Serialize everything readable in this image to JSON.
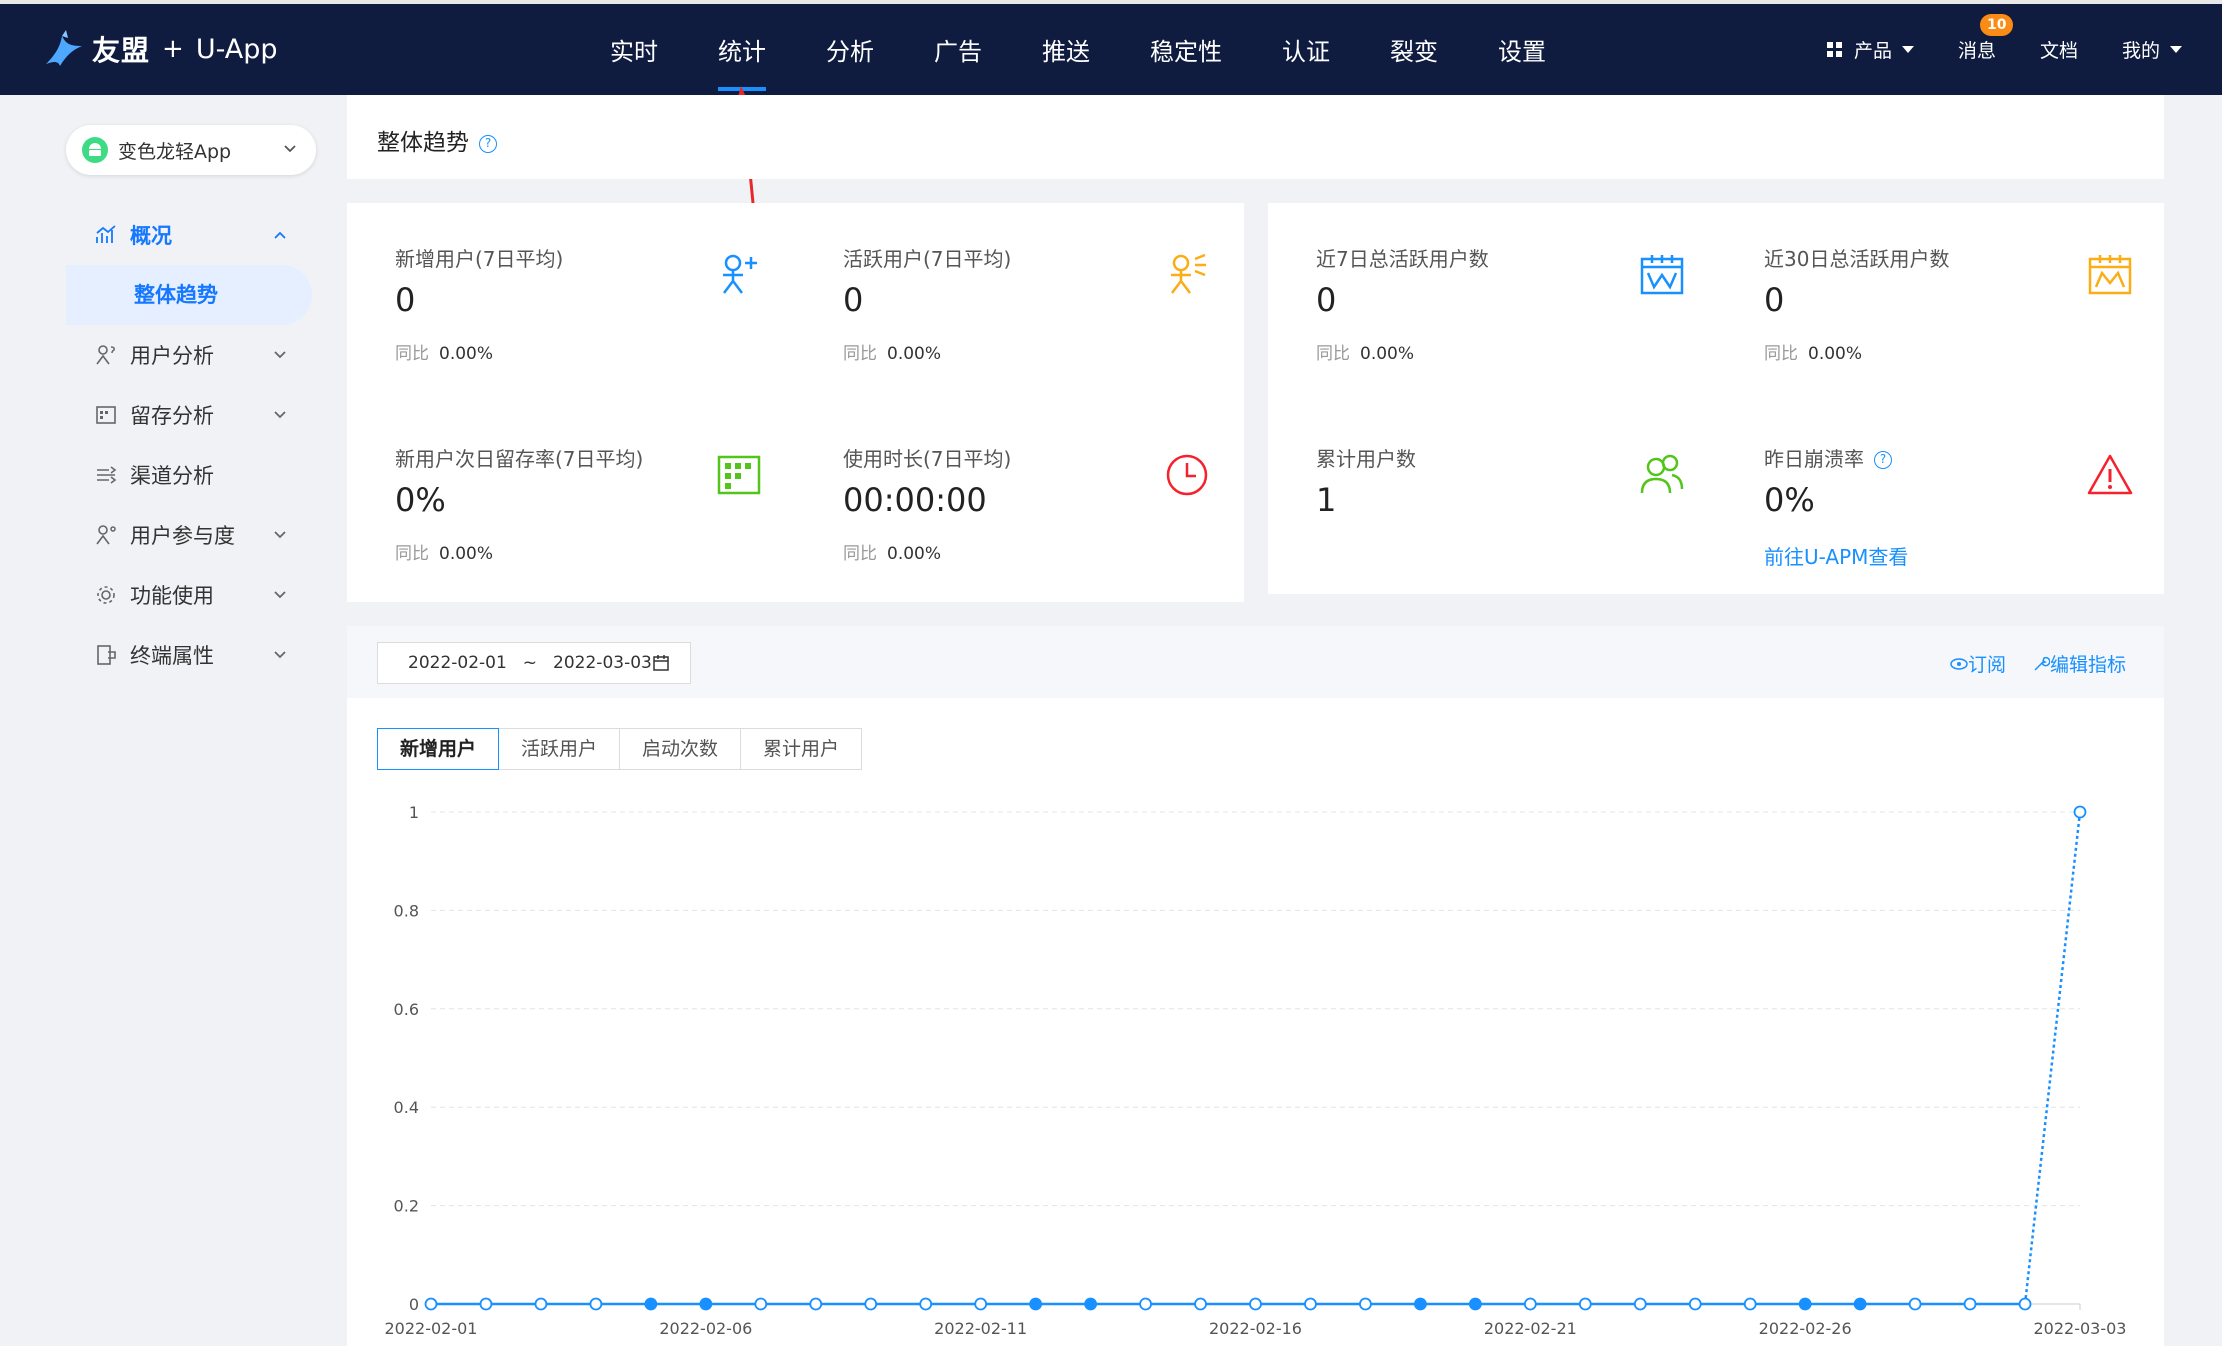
{
  "header": {
    "brand": "友盟",
    "plus": "+",
    "app_name": "U-App",
    "nav": [
      "实时",
      "统计",
      "分析",
      "广告",
      "推送",
      "稳定性",
      "认证",
      "裂变",
      "设置"
    ],
    "active_nav": 1,
    "right": {
      "products": "产品",
      "messages": "消息",
      "message_count": "10",
      "docs": "文档",
      "mine": "我的"
    }
  },
  "sidebar": {
    "app_selector": "变色龙轻App",
    "menu": [
      {
        "label": "概况",
        "icon": "chart-icon",
        "expanded": true
      },
      {
        "label": "用户分析",
        "icon": "user-question-icon"
      },
      {
        "label": "留存分析",
        "icon": "calendar-grid-icon"
      },
      {
        "label": "渠道分析",
        "icon": "channel-icon"
      },
      {
        "label": "用户参与度",
        "icon": "user-engage-icon"
      },
      {
        "label": "功能使用",
        "icon": "gear-icon"
      },
      {
        "label": "终端属性",
        "icon": "device-icon"
      }
    ],
    "submenu_active": "整体趋势"
  },
  "page": {
    "title": "整体趋势"
  },
  "cards": {
    "new_users": {
      "label": "新增用户(7日平均)",
      "value": "0",
      "cmp_label": "同比",
      "cmp_value": "0.00%"
    },
    "active_users": {
      "label": "活跃用户(7日平均)",
      "value": "0",
      "cmp_label": "同比",
      "cmp_value": "0.00%"
    },
    "retention": {
      "label": "新用户次日留存率(7日平均)",
      "value": "0%",
      "cmp_label": "同比",
      "cmp_value": "0.00%"
    },
    "duration": {
      "label": "使用时长(7日平均)",
      "value": "00:00:00",
      "cmp_label": "同比",
      "cmp_value": "0.00%"
    },
    "active7": {
      "label": "近7日总活跃用户数",
      "value": "0",
      "cmp_label": "同比",
      "cmp_value": "0.00%"
    },
    "active30": {
      "label": "近30日总活跃用户数",
      "value": "0",
      "cmp_label": "同比",
      "cmp_value": "0.00%"
    },
    "total_users": {
      "label": "累计用户数",
      "value": "1"
    },
    "crash": {
      "label": "昨日崩溃率",
      "value": "0%",
      "link": "前往U-APM查看"
    }
  },
  "colors": {
    "nav_bg": "#0f1c3f",
    "accent": "#1890ff",
    "orange": "#faad14",
    "green": "#52c41a",
    "red": "#f5222d"
  },
  "trend": {
    "date_start": "2022-02-01",
    "date_sep": "~",
    "date_end": "2022-03-03",
    "subscribe": "订阅",
    "edit_metrics": "编辑指标",
    "tabs": [
      "新增用户",
      "活跃用户",
      "启动次数",
      "累计用户"
    ],
    "active_tab": 0
  },
  "chart_data": {
    "type": "line",
    "x": [
      "2022-02-01",
      "2022-02-02",
      "2022-02-03",
      "2022-02-04",
      "2022-02-05",
      "2022-02-06",
      "2022-02-07",
      "2022-02-08",
      "2022-02-09",
      "2022-02-10",
      "2022-02-11",
      "2022-02-12",
      "2022-02-13",
      "2022-02-14",
      "2022-02-15",
      "2022-02-16",
      "2022-02-17",
      "2022-02-18",
      "2022-02-19",
      "2022-02-20",
      "2022-02-21",
      "2022-02-22",
      "2022-02-23",
      "2022-02-24",
      "2022-02-25",
      "2022-02-26",
      "2022-02-27",
      "2022-02-28",
      "2022-03-01",
      "2022-03-02",
      "2022-03-03"
    ],
    "values": [
      0,
      0,
      0,
      0,
      0,
      0,
      0,
      0,
      0,
      0,
      0,
      0,
      0,
      0,
      0,
      0,
      0,
      0,
      0,
      0,
      0,
      0,
      0,
      0,
      0,
      0,
      0,
      0,
      0,
      0,
      1
    ],
    "weekend_points": [
      4,
      5,
      11,
      12,
      18,
      19,
      25,
      26
    ],
    "x_tick_labels": [
      "2022-02-01",
      "2022-02-06",
      "2022-02-11",
      "2022-02-16",
      "2022-02-21",
      "2022-02-26",
      "2022-03-03"
    ],
    "y_ticks": [
      "0",
      "0.2",
      "0.4",
      "0.6",
      "0.8",
      "1"
    ],
    "ylim": [
      0,
      1
    ],
    "grid": true,
    "color": "#1890ff"
  }
}
